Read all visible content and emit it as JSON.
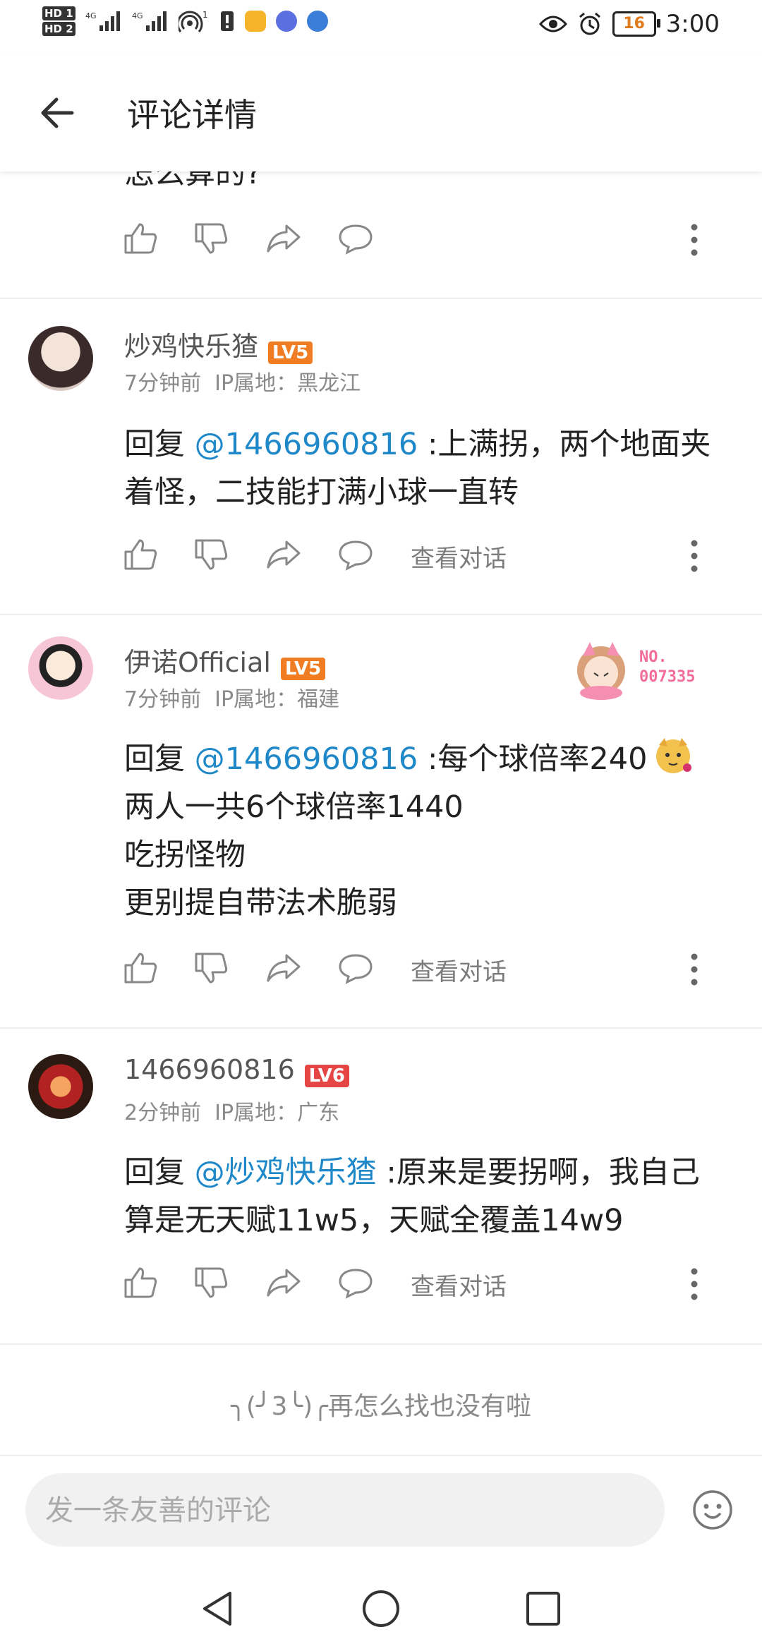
{
  "status_bar": {
    "hd1": "HD 1",
    "hd2": "HD 2",
    "signal1": "4G",
    "signal2": "4G",
    "hotspot_count": "1",
    "battery": "16",
    "time": "3:00"
  },
  "header": {
    "title": "评论详情"
  },
  "top_partial": {
    "text": "怎么算的?"
  },
  "comments": [
    {
      "username": "炒鸡快乐猹",
      "level": "LV5",
      "level_color": "#f07c24",
      "time": "7分钟前",
      "ip": "IP属地：黑龙江",
      "reply_prefix": "回复",
      "mention": "@1466960816",
      "lines": [
        ":上满拐，两个地面夹",
        "着怪，二技能打满小球一直转"
      ],
      "view_label": "查看对话"
    },
    {
      "username": "伊诺Official",
      "level": "LV5",
      "level_color": "#f07c24",
      "time": "7分钟前",
      "ip": "IP属地：福建",
      "badge": "NO.\n007335",
      "reply_prefix": "回复",
      "mention": "@1466960816",
      "lines": [
        ":每个球倍率240",
        "两人一共6个球倍率1440",
        "吃拐怪物",
        "更别提自带法术脆弱"
      ],
      "view_label": "查看对话"
    },
    {
      "username": "1466960816",
      "level": "LV6",
      "level_color": "#e64545",
      "time": "2分钟前",
      "ip": "IP属地：广东",
      "reply_prefix": "回复",
      "mention": "@炒鸡快乐猹",
      "lines": [
        ":原来是要拐啊，我自己",
        "算是无天赋11w5，天赋全覆盖14w9"
      ],
      "view_label": "查看对话"
    }
  ],
  "end_text": "╮(╯3╰)╭再怎么找也没有啦",
  "input": {
    "placeholder": "发一条友善的评论"
  },
  "colors": {
    "mention": "#1e88c8",
    "lv5": "#f07c24",
    "lv6": "#e64545"
  }
}
